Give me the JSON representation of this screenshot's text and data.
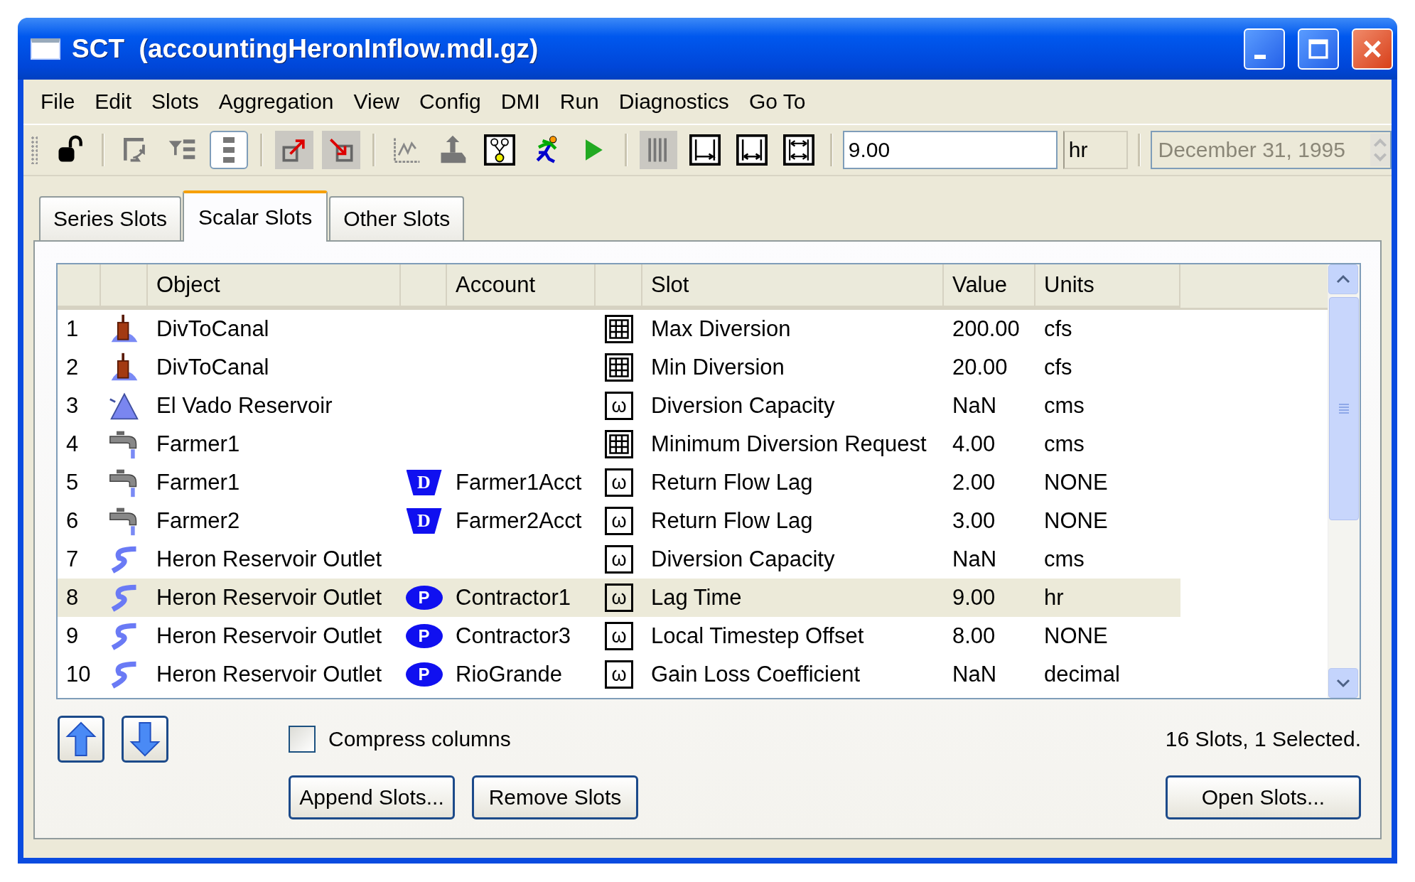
{
  "window": {
    "title": "SCT  (accountingHeronInflow.mdl.gz)"
  },
  "menu": [
    "File",
    "Edit",
    "Slots",
    "Aggregation",
    "View",
    "Config",
    "DMI",
    "Run",
    "Diagnostics",
    "Go To"
  ],
  "toolbar": {
    "groups": [
      [
        {
          "kind": "lock",
          "checked": false,
          "focused": false
        }
      ],
      [
        {
          "kind": "swap",
          "checked": false,
          "focused": false
        },
        {
          "kind": "filter",
          "checked": false,
          "focused": false
        },
        {
          "kind": "list",
          "checked": false,
          "focused": true
        }
      ],
      [
        {
          "kind": "export",
          "checked": true,
          "focused": false
        },
        {
          "kind": "import",
          "checked": true,
          "focused": false
        }
      ],
      [
        {
          "kind": "plot",
          "checked": false,
          "focused": false
        },
        {
          "kind": "hand",
          "checked": false,
          "focused": false
        },
        {
          "kind": "network",
          "checked": false,
          "focused": false
        },
        {
          "kind": "runner",
          "checked": false,
          "focused": false
        },
        {
          "kind": "play",
          "checked": false,
          "focused": false
        }
      ],
      [
        {
          "kind": "columns",
          "checked": true,
          "focused": false
        },
        {
          "kind": "fit_left",
          "checked": false,
          "focused": false
        },
        {
          "kind": "fit_both",
          "checked": false,
          "focused": false
        },
        {
          "kind": "fit_all",
          "checked": false,
          "focused": false
        }
      ]
    ],
    "value": "9.00",
    "unit": "hr",
    "date": {
      "value": "December 31, 1995",
      "disabled": true
    }
  },
  "tabs": [
    {
      "label": "Series Slots",
      "selected": false
    },
    {
      "label": "Scalar Slots",
      "selected": true
    },
    {
      "label": "Other Slots",
      "selected": false
    }
  ],
  "table": {
    "columns": [
      "Object",
      "Account",
      "Slot",
      "Value",
      "Units"
    ],
    "rows": [
      {
        "number": "1",
        "object": {
          "kind": "diversion",
          "name": "DivToCanal"
        },
        "slot": {
          "kind": "table",
          "name": "Max Diversion"
        },
        "value": "200.00",
        "units": "cfs",
        "selected": false
      },
      {
        "number": "2",
        "object": {
          "kind": "diversion",
          "name": "DivToCanal"
        },
        "slot": {
          "kind": "table",
          "name": "Min Diversion"
        },
        "value": "20.00",
        "units": "cfs",
        "selected": false
      },
      {
        "number": "3",
        "object": {
          "kind": "reservoir",
          "name": "El Vado Reservoir"
        },
        "slot": {
          "kind": "scalar",
          "symbol": "ω",
          "name": "Diversion Capacity"
        },
        "value": "NaN",
        "units": "cms",
        "selected": false
      },
      {
        "number": "4",
        "object": {
          "kind": "water_user",
          "name": "Farmer1"
        },
        "slot": {
          "kind": "table",
          "name": "Minimum Diversion Request"
        },
        "value": "4.00",
        "units": "cms",
        "selected": false
      },
      {
        "number": "5",
        "object": {
          "kind": "water_user",
          "name": "Farmer1"
        },
        "account": {
          "kind": "trapezoid",
          "badge": "D",
          "name": "Farmer1Acct"
        },
        "slot": {
          "kind": "scalar",
          "symbol": "ω",
          "name": "Return Flow Lag"
        },
        "value": "2.00",
        "units": "NONE",
        "selected": false
      },
      {
        "number": "6",
        "object": {
          "kind": "water_user",
          "name": "Farmer2"
        },
        "account": {
          "kind": "trapezoid",
          "badge": "D",
          "name": "Farmer2Acct"
        },
        "slot": {
          "kind": "scalar",
          "symbol": "ω",
          "name": "Return Flow Lag"
        },
        "value": "3.00",
        "units": "NONE",
        "selected": false
      },
      {
        "number": "7",
        "object": {
          "kind": "reach",
          "name": "Heron Reservoir Outlet"
        },
        "slot": {
          "kind": "scalar",
          "symbol": "ω",
          "name": "Diversion Capacity"
        },
        "value": "NaN",
        "units": "cms",
        "selected": false
      },
      {
        "number": "8",
        "object": {
          "kind": "reach",
          "name": "Heron Reservoir Outlet"
        },
        "account": {
          "kind": "oval",
          "badge": "P",
          "name": "Contractor1"
        },
        "slot": {
          "kind": "scalar",
          "symbol": "ω",
          "name": "Lag Time"
        },
        "value": "9.00",
        "units": "hr",
        "selected": true
      },
      {
        "number": "9",
        "object": {
          "kind": "reach",
          "name": "Heron Reservoir Outlet"
        },
        "account": {
          "kind": "oval",
          "badge": "P",
          "name": "Contractor3"
        },
        "slot": {
          "kind": "scalar",
          "symbol": "ω",
          "name": "Local Timestep Offset"
        },
        "value": "8.00",
        "units": "NONE",
        "selected": false
      },
      {
        "number": "10",
        "object": {
          "kind": "reach",
          "name": "Heron Reservoir Outlet"
        },
        "account": {
          "kind": "oval",
          "badge": "P",
          "name": "RioGrande"
        },
        "slot": {
          "kind": "scalar",
          "symbol": "ω",
          "name": "Gain Loss Coefficient"
        },
        "value": "NaN",
        "units": "decimal",
        "selected": false
      }
    ]
  },
  "compress_columns": {
    "label": "Compress columns",
    "checked": false
  },
  "status": "16 Slots, 1 Selected.",
  "buttons": [
    "Append Slots...",
    "Remove Slots",
    "Open Slots..."
  ]
}
